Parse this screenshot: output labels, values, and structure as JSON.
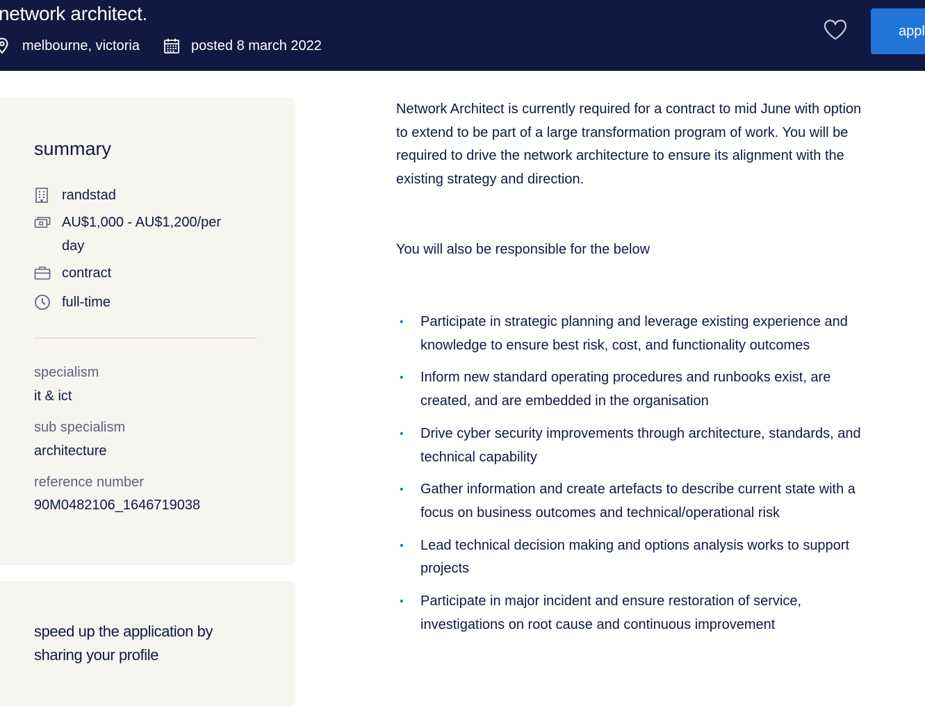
{
  "header": {
    "title": "network architect.",
    "location": "melbourne, victoria",
    "posted": "posted 8 march 2022",
    "apply_label": "apply"
  },
  "summary": {
    "title": "summary",
    "company": "randstad",
    "salary": "AU$1,000 - AU$1,200/per day",
    "job_type": "contract",
    "hours": "full-time",
    "specialism_label": "specialism",
    "specialism": "it & ict",
    "sub_specialism_label": "sub specialism",
    "sub_specialism": "architecture",
    "reference_label": "reference number",
    "reference": "90M0482106_1646719038"
  },
  "profile_card": {
    "text": "speed up the application by sharing your profile"
  },
  "description": {
    "intro": "Network Architect is currently required for a contract to mid June with option to extend to be part of a large transformation program of work. You will be required to drive the network architecture to ensure its alignment with the existing strategy and direction.",
    "lead": "You will also be responsible for the below",
    "items": [
      "Participate in strategic planning and leverage existing experience and knowledge to ensure best risk, cost, and functionality outcomes",
      "Inform new standard operating procedures and runbooks exist, are created, and are embedded in the organisation",
      "Drive cyber security improvements through architecture, standards, and technical capability",
      "Gather information and create artefacts to describe current state with a focus on business outcomes and technical/operational risk",
      "Lead technical decision making and options analysis works to support projects",
      "Participate in major incident and ensure restoration of service, investigations on root cause and continuous improvement"
    ]
  },
  "icons": {
    "location": "location-pin-icon",
    "calendar": "calendar-icon",
    "favorite": "heart-icon",
    "company": "building-icon",
    "salary": "money-icon",
    "job_type": "briefcase-icon",
    "hours": "clock-icon"
  },
  "colors": {
    "header_bg": "#0f1941",
    "accent": "#2175d9",
    "card_bg": "#f7f5f0",
    "text": "#0f1941",
    "muted_text": "#5d6180"
  }
}
